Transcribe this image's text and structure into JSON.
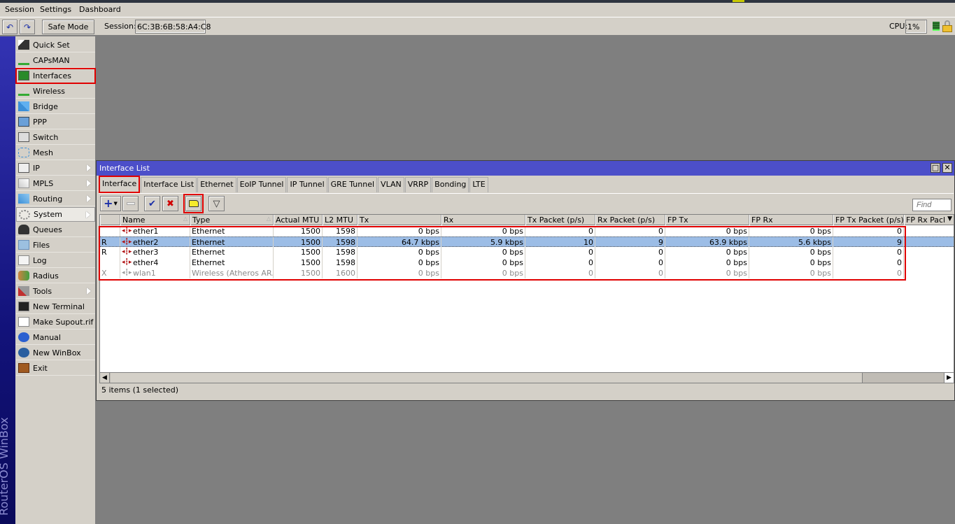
{
  "menubar": {
    "items": [
      "Session",
      "Settings",
      "Dashboard"
    ]
  },
  "toolbar": {
    "undo_icon": "undo-icon",
    "redo_icon": "redo-icon",
    "safe_mode_label": "Safe Mode",
    "session_label": "Session:",
    "session_value": "6C:3B:6B:58:A4:C8",
    "cpu_label": "CPU:",
    "cpu_value": "1%"
  },
  "brand": "RouterOS WinBox",
  "sidebar": {
    "items": [
      {
        "label": "Quick Set",
        "icon": "wand-icon"
      },
      {
        "label": "CAPsMAN",
        "icon": "antenna-icon"
      },
      {
        "label": "Interfaces",
        "icon": "network-card-icon",
        "highlighted": true
      },
      {
        "label": "Wireless",
        "icon": "antenna-icon"
      },
      {
        "label": "Bridge",
        "icon": "bridge-icon"
      },
      {
        "label": "PPP",
        "icon": "ppp-icon"
      },
      {
        "label": "Switch",
        "icon": "switch-icon"
      },
      {
        "label": "Mesh",
        "icon": "mesh-icon"
      },
      {
        "label": "IP",
        "icon": "ip-icon",
        "submenu": true
      },
      {
        "label": "MPLS",
        "icon": "mpls-icon",
        "submenu": true
      },
      {
        "label": "Routing",
        "icon": "routing-icon",
        "submenu": true
      },
      {
        "label": "System",
        "icon": "gear-icon",
        "submenu": true
      },
      {
        "label": "Queues",
        "icon": "gauge-icon"
      },
      {
        "label": "Files",
        "icon": "folder-icon"
      },
      {
        "label": "Log",
        "icon": "log-icon"
      },
      {
        "label": "Radius",
        "icon": "users-icon"
      },
      {
        "label": "Tools",
        "icon": "tools-icon",
        "submenu": true
      },
      {
        "label": "New Terminal",
        "icon": "terminal-icon"
      },
      {
        "label": "Make Supout.rif",
        "icon": "document-icon"
      },
      {
        "label": "Manual",
        "icon": "help-icon"
      },
      {
        "label": "New WinBox",
        "icon": "winbox-icon"
      },
      {
        "label": "Exit",
        "icon": "exit-door-icon"
      }
    ]
  },
  "window": {
    "title": "Interface List",
    "tabs": [
      "Interface",
      "Interface List",
      "Ethernet",
      "EoIP Tunnel",
      "IP Tunnel",
      "GRE Tunnel",
      "VLAN",
      "VRRP",
      "Bonding",
      "LTE"
    ],
    "active_tab": "Interface",
    "find_placeholder": "Find",
    "columns": [
      "",
      "Name",
      "Type",
      "Actual MTU",
      "L2 MTU",
      "Tx",
      "Rx",
      "Tx Packet (p/s)",
      "Rx Packet (p/s)",
      "FP Tx",
      "FP Rx",
      "FP Tx Packet (p/s)",
      "FP Rx Pacl"
    ],
    "rows": [
      {
        "flag": "",
        "name": "ether1",
        "type": "Ethernet",
        "actual_mtu": "1500",
        "l2_mtu": "1598",
        "tx": "0 bps",
        "rx": "0 bps",
        "tx_pps": "0",
        "rx_pps": "0",
        "fp_tx": "0 bps",
        "fp_rx": "0 bps",
        "fp_tx_pps": "0",
        "fp_rx_pps": ""
      },
      {
        "flag": "R",
        "name": "ether2",
        "type": "Ethernet",
        "actual_mtu": "1500",
        "l2_mtu": "1598",
        "tx": "64.7 kbps",
        "rx": "5.9 kbps",
        "tx_pps": "10",
        "rx_pps": "9",
        "fp_tx": "63.9 kbps",
        "fp_rx": "5.6 kbps",
        "fp_tx_pps": "9",
        "fp_rx_pps": "",
        "selected": true
      },
      {
        "flag": "R",
        "name": "ether3",
        "type": "Ethernet",
        "actual_mtu": "1500",
        "l2_mtu": "1598",
        "tx": "0 bps",
        "rx": "0 bps",
        "tx_pps": "0",
        "rx_pps": "0",
        "fp_tx": "0 bps",
        "fp_rx": "0 bps",
        "fp_tx_pps": "0",
        "fp_rx_pps": ""
      },
      {
        "flag": "",
        "name": "ether4",
        "type": "Ethernet",
        "actual_mtu": "1500",
        "l2_mtu": "1598",
        "tx": "0 bps",
        "rx": "0 bps",
        "tx_pps": "0",
        "rx_pps": "0",
        "fp_tx": "0 bps",
        "fp_rx": "0 bps",
        "fp_tx_pps": "0",
        "fp_rx_pps": ""
      },
      {
        "flag": "X",
        "name": "wlan1",
        "type": "Wireless (Atheros AR..",
        "actual_mtu": "1500",
        "l2_mtu": "1600",
        "tx": "0 bps",
        "rx": "0 bps",
        "tx_pps": "0",
        "rx_pps": "0",
        "fp_tx": "0 bps",
        "fp_rx": "0 bps",
        "fp_tx_pps": "0",
        "fp_rx_pps": "",
        "disabled": true
      }
    ],
    "status": "5 items (1 selected)"
  },
  "colors": {
    "title_bar": "#4c4fc9",
    "highlight_box": "#e00000",
    "selected_row": "#9cbde6",
    "panel": "#d4d0c8"
  }
}
